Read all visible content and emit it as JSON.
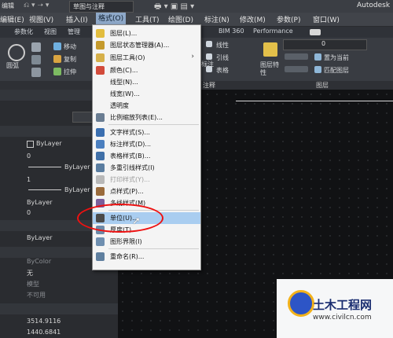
{
  "titlebar": {
    "left_label": "编辑",
    "workspace": "草图与注释",
    "app_title": "Autodesk"
  },
  "menubar": {
    "items": [
      "编辑(E)",
      "视图(V)",
      "插入(I)",
      "格式(O)",
      "工具(T)",
      "绘图(D)",
      "标注(N)",
      "修改(M)",
      "参数(P)",
      "窗口(W)"
    ]
  },
  "tabs": {
    "items": [
      "参数化",
      "视图",
      "管理",
      "BIM 360",
      "Performance"
    ]
  },
  "ribbon": {
    "left_labels": [
      "圆弧",
      "移动",
      "复制",
      "拉伸"
    ],
    "right_labels": [
      "线性",
      "引线",
      "表格",
      "标注",
      "图层特性",
      "置为当前",
      "匹配图层"
    ],
    "layer_value": "0",
    "annotation_label": "注释",
    "layers_label": "图层"
  },
  "left_panel": {
    "rows": [
      "ByLayer",
      "0",
      "ByLayer",
      "1",
      "ByLayer",
      "ByLayer",
      "0",
      "ByLayer",
      "ByColor",
      "无",
      "模型",
      "不可用",
      "3514.9116",
      "1440.6841"
    ]
  },
  "format_menu": {
    "items": [
      {
        "label": "图层(L)...",
        "icon": "layer-icon"
      },
      {
        "label": "图层状态管理器(A)...",
        "icon": "layer-state-icon"
      },
      {
        "label": "图层工具(O)",
        "icon": "layer-tools-icon",
        "submenu": true
      },
      {
        "label": "颜色(C)...",
        "icon": "color-icon"
      },
      {
        "label": "线型(N)...",
        "icon": ""
      },
      {
        "label": "线宽(W)...",
        "icon": ""
      },
      {
        "label": "透明度",
        "icon": ""
      },
      {
        "label": "比例缩放列表(E)...",
        "icon": "scale-list-icon"
      },
      {
        "label": "文字样式(S)...",
        "icon": "text-style-icon"
      },
      {
        "label": "标注样式(D)...",
        "icon": "dim-style-icon"
      },
      {
        "label": "表格样式(B)...",
        "icon": "table-style-icon"
      },
      {
        "label": "多重引线样式(I)",
        "icon": "mleader-style-icon"
      },
      {
        "label": "打印样式(Y)...",
        "icon": "plot-style-icon",
        "disabled": true
      },
      {
        "label": "点样式(P)...",
        "icon": "point-style-icon"
      },
      {
        "label": "多线样式(M)",
        "icon": "mline-style-icon"
      },
      {
        "label": "单位(U)...",
        "icon": "units-icon",
        "highlighted": true
      },
      {
        "label": "厚度(T)",
        "icon": "thickness-icon"
      },
      {
        "label": "图形界限(I)",
        "icon": "limits-icon"
      },
      {
        "label": "重命名(R)...",
        "icon": "rename-icon"
      }
    ]
  },
  "watermark": {
    "title": "土木工程网",
    "url": "www.civilcn.com"
  },
  "colors": {
    "highlight": "#a9cdf0",
    "annotation_circle": "#e11111"
  }
}
